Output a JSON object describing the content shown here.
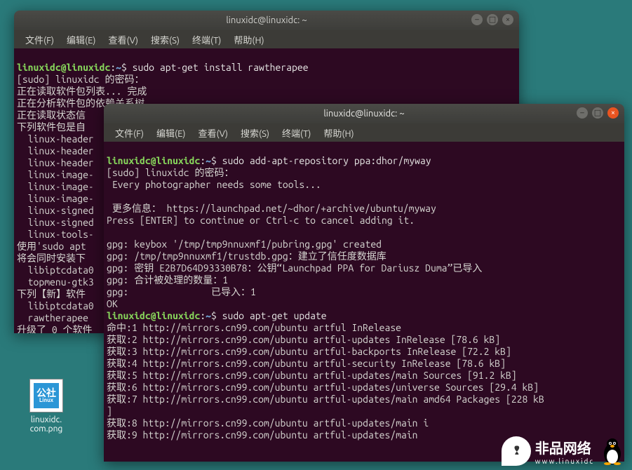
{
  "desktop_icon": {
    "label": "linuxidc.\ncom.png",
    "badge1": "公社",
    "badge2": "Linux"
  },
  "menu": {
    "file": "文件(F)",
    "edit": "编辑(E)",
    "view": "查看(V)",
    "search": "搜索(S)",
    "terminal": "终端(T)",
    "help": "帮助(H)"
  },
  "win1": {
    "title": "linuxidc@linuxidc: ~",
    "prompt_user": "linuxidc@linuxidc",
    "prompt_sep": ":",
    "prompt_path": "~",
    "prompt_end": "$ ",
    "cmd": "sudo apt-get install rawtherapee",
    "l1": "[sudo] linuxidc 的密码：",
    "l2": "正在读取软件包列表... 完成",
    "l3": "正在分析软件包的依赖关系树",
    "l4": "正在读取状态信",
    "l5": "下列软件包是自",
    "l6": "  linux-header",
    "l7": "  linux-header",
    "l8": "  linux-header",
    "l9": "  linux-image-",
    "l10": "  linux-image-",
    "l11": "  linux-image-",
    "l12": "  linux-signed",
    "l13": "  linux-signed",
    "l14": "  linux-tools-",
    "l15": "使用'sudo apt ",
    "l16": "将会同时安装下",
    "l17": "  libiptcdata0",
    "l18": "  topmenu-gtk3",
    "l19": "下列【新】软件",
    "l20": "  libiptcdata0",
    "l21": "  rawtherapee",
    "l22": "升级了 0 个软件"
  },
  "win2": {
    "title": "linuxidc@linuxidc: ~",
    "prompt_user": "linuxidc@linuxidc",
    "prompt_sep": ":",
    "prompt_path": "~",
    "prompt_end": "$ ",
    "cmd1": "sudo add-apt-repository ppa:dhor/myway",
    "l1": "[sudo] linuxidc 的密码：",
    "l2": " Every photographer needs some tools...",
    "l3": "",
    "l4": " 更多信息： https://launchpad.net/~dhor/+archive/ubuntu/myway",
    "l5": "Press [ENTER] to continue or Ctrl-c to cancel adding it.",
    "l6": "",
    "l7": "gpg: keybox '/tmp/tmp9nnuxmf1/pubring.gpg' created",
    "l8": "gpg: /tmp/tmp9nnuxmf1/trustdb.gpg：建立了信任度数据库",
    "l9": "gpg: 密钥 E2B7D64D93330B78：公钥“Launchpad PPA for Dariusz Duma”已导入",
    "l10": "gpg: 合计被处理的数量：1",
    "l11": "gpg:               已导入：1",
    "l12": "OK",
    "cmd2": "sudo apt-get update",
    "l13": "命中:1 http://mirrors.cn99.com/ubuntu artful InRelease",
    "l14": "获取:2 http://mirrors.cn99.com/ubuntu artful-updates InRelease [78.6 kB]",
    "l15": "获取:3 http://mirrors.cn99.com/ubuntu artful-backports InRelease [72.2 kB]",
    "l16": "获取:4 http://mirrors.cn99.com/ubuntu artful-security InRelease [78.6 kB]",
    "l17": "获取:5 http://mirrors.cn99.com/ubuntu artful-updates/main Sources [91.2 kB]",
    "l18": "获取:6 http://mirrors.cn99.com/ubuntu artful-updates/universe Sources [29.4 kB]",
    "l19": "获取:7 http://mirrors.cn99.com/ubuntu artful-updates/main amd64 Packages [228 kB",
    "l20": "]",
    "l21": "获取:8 http://mirrors.cn99.com/ubuntu artful-updates/main i",
    "l22": "获取:9 http://mirrors.cn99.com/ubuntu artful-updates/main"
  },
  "watermark": {
    "text": "非品网络",
    "sub": "www.linuxidc"
  }
}
